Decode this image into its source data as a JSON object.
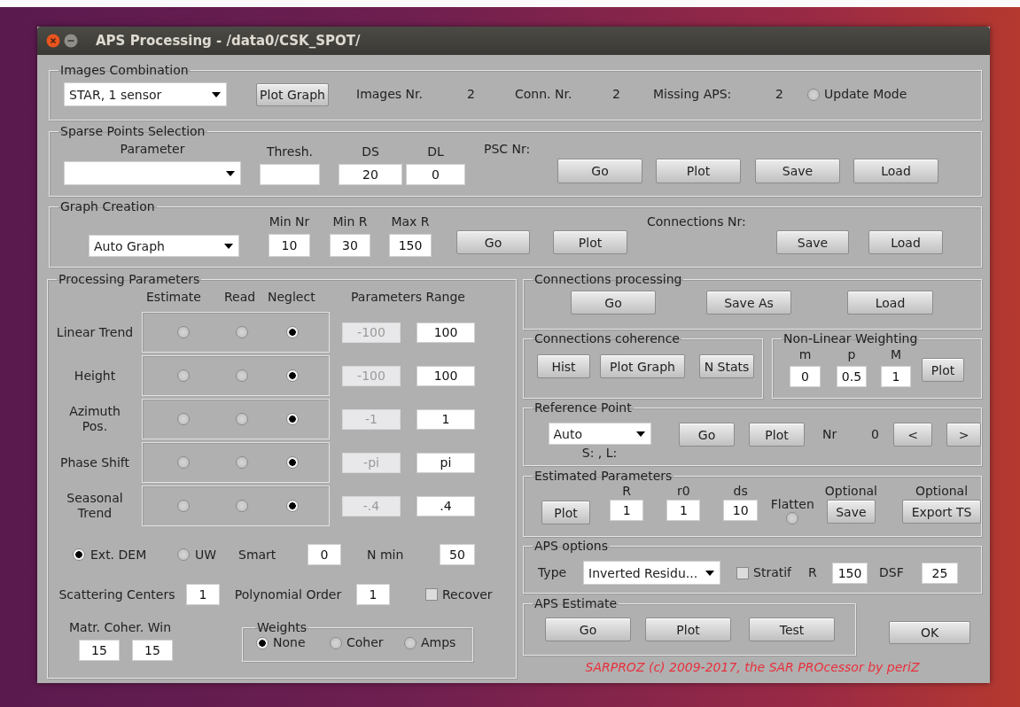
{
  "window": {
    "title": "APS Processing - /data0/CSK_SPOT/"
  },
  "images_combination": {
    "title": "Images Combination",
    "combination": "STAR, 1 sensor",
    "plot_graph_button": "Plot Graph",
    "images_label": "Images Nr.",
    "images_value": "2",
    "connections_label": "Conn. Nr.",
    "connections_value": "2",
    "missing_label": "Missing APS:",
    "missing_value": "2",
    "update_mode": {
      "label": "Update Mode",
      "selected": false
    }
  },
  "sparse_points_selection": {
    "title": "Sparse Points Selection",
    "parameter_label": "Parameter",
    "thresh_label": "Thresh.",
    "ds_label": "DS",
    "ds_value": "20",
    "dl_label": "DL",
    "dl_value": "0",
    "psc_label": "PSC Nr:",
    "buttons": [
      "Go",
      "Plot",
      "Save",
      "Load"
    ]
  },
  "graph_creation": {
    "title": "Graph Creation",
    "method": "Auto Graph",
    "min_nr_label": "Min Nr",
    "min_nr_value": "10",
    "min_r_label": "Min R",
    "min_r_value": "30",
    "max_r_label": "Max R",
    "max_r_value": "150",
    "go_button": "Go",
    "plot_button": "Plot",
    "connections_label": "Connections Nr:",
    "save_button": "Save",
    "load_button": "Load"
  },
  "processing_parameters": {
    "title": "Processing Parameters",
    "option_headers": [
      "Estimate",
      "Read",
      "Neglect"
    ],
    "range_header": "Parameters Range",
    "rows": [
      {
        "label": "Linear Trend",
        "options": [
          {
            "selected": false
          },
          {
            "selected": false
          },
          {
            "selected": true
          }
        ],
        "min": {
          "value": "-100",
          "disabled": true
        },
        "max": "100"
      },
      {
        "label": "Height",
        "options": [
          {
            "selected": false
          },
          {
            "selected": false
          },
          {
            "selected": true
          }
        ],
        "min": {
          "value": "-100",
          "disabled": true
        },
        "max": "100"
      },
      {
        "label": "Azimuth Pos.",
        "options": [
          {
            "selected": false
          },
          {
            "selected": false
          },
          {
            "selected": true
          }
        ],
        "min": {
          "value": "-1",
          "disabled": true
        },
        "max": "1"
      },
      {
        "label": "Phase Shift",
        "options": [
          {
            "selected": false
          },
          {
            "selected": false
          },
          {
            "selected": true
          }
        ],
        "min": {
          "value": "-pi",
          "disabled": true
        },
        "max": "pi"
      },
      {
        "label": "Seasonal Trend",
        "options": [
          {
            "selected": false
          },
          {
            "selected": false
          },
          {
            "selected": true
          }
        ],
        "min": {
          "value": "-.4",
          "disabled": true
        },
        "max": ".4"
      }
    ],
    "ext_dem": {
      "label": "Ext. DEM",
      "selected": true
    },
    "uw": {
      "label": "UW",
      "selected": false
    },
    "smart_label": "Smart",
    "smart_value": "0",
    "n_min_label": "N min",
    "n_min_value": "50",
    "scattering_label": "Scattering Centers",
    "scattering_value": "1",
    "polynomial_label": "Polynomial Order",
    "polynomial_value": "1",
    "recover": {
      "label": "Recover",
      "checked": false
    },
    "coherence_window_label": "Matr. Coher. Win",
    "coherence_window_values": [
      "15",
      "15"
    ],
    "weights": {
      "title": "Weights",
      "options": [
        {
          "label": "None",
          "selected": true
        },
        {
          "label": "Coher",
          "selected": false
        },
        {
          "label": "Amps",
          "selected": false
        }
      ]
    }
  },
  "connections_processing": {
    "title": "Connections processing",
    "buttons": [
      "Go",
      "Save As",
      "Load"
    ]
  },
  "connections_coherence": {
    "title": "Connections coherence",
    "buttons": [
      "Hist",
      "Plot Graph",
      "N Stats"
    ]
  },
  "non_linear_weighting": {
    "title": "Non-Linear Weighting",
    "params": [
      {
        "label": "m",
        "value": "0"
      },
      {
        "label": "p",
        "value": "0.5"
      },
      {
        "label": "M",
        "value": "1"
      }
    ],
    "plot_button": "Plot"
  },
  "reference_point": {
    "title": "Reference Point",
    "mode": "Auto",
    "position": "S: , L:",
    "go_button": "Go",
    "plot_button": "Plot",
    "nr_label": "Nr",
    "nr_value": "0",
    "prev_button": "<",
    "next_button": ">"
  },
  "estimated_parameters": {
    "title": "Estimated Parameters",
    "plot_button": "Plot",
    "params": [
      {
        "label": "R",
        "value": "1"
      },
      {
        "label": "r0",
        "value": "1"
      },
      {
        "label": "ds",
        "value": "10"
      }
    ],
    "flatten": {
      "label": "Flatten",
      "selected": false
    },
    "save_label": "Optional",
    "save_button": "Save",
    "export_label": "Optional",
    "export_button": "Export TS"
  },
  "aps_options": {
    "title": "APS options",
    "type_label": "Type",
    "type": "Inverted Residu...",
    "stratif": {
      "label": "Stratif",
      "checked": false
    },
    "r_label": "R",
    "r_value": "150",
    "dsf_label": "DSF",
    "dsf_value": "25"
  },
  "aps_estimate": {
    "title": "APS Estimate",
    "buttons": [
      "Go",
      "Plot",
      "Test"
    ]
  },
  "ok_button": "OK",
  "footer": "SARPROZ (c) 2009-2017, the SAR PROcessor by periZ"
}
